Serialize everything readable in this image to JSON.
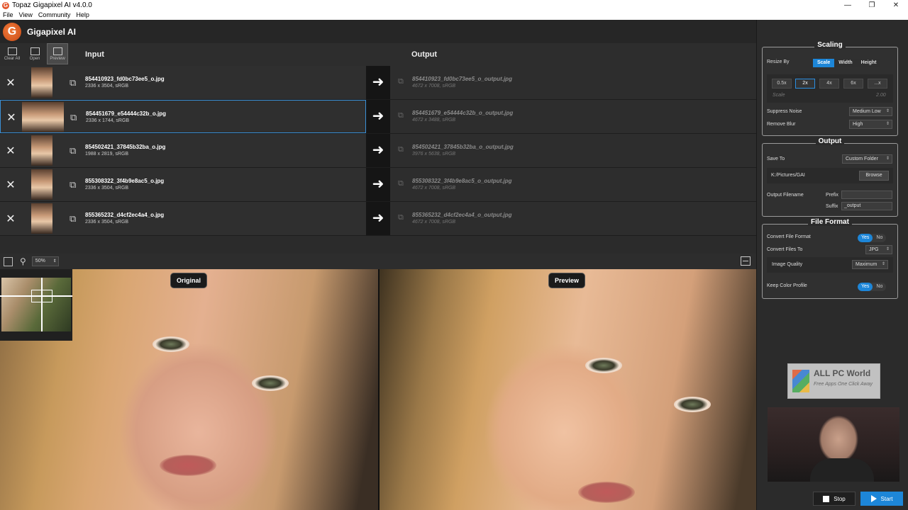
{
  "window": {
    "title": "Topaz Gigapixel AI v4.0.0"
  },
  "menu": [
    "File",
    "View",
    "Community",
    "Help"
  ],
  "app": {
    "name": "Gigapixel AI"
  },
  "toolbar": {
    "clear_all": "Clear All",
    "open": "Open",
    "preview": "Preview"
  },
  "columns": {
    "input": "Input",
    "output": "Output"
  },
  "files": [
    {
      "name": "854410923_fd0bc73ee5_o.jpg",
      "meta": "2336 x 3504, sRGB",
      "out_name": "854410923_fd0bc73ee5_o_output.jpg",
      "out_meta": "4672 x 7008, sRGB"
    },
    {
      "name": "854451679_e54444c32b_o.jpg",
      "meta": "2336 x 1744, sRGB",
      "out_name": "854451679_e54444c32b_o_output.jpg",
      "out_meta": "4672 x 3488, sRGB"
    },
    {
      "name": "854502421_37845b32ba_o.jpg",
      "meta": "1988 x 2819, sRGB",
      "out_name": "854502421_37845b32ba_o_output.jpg",
      "out_meta": "3976 x 5638, sRGB"
    },
    {
      "name": "855308322_3f4b9e8ac5_o.jpg",
      "meta": "2336 x 3504, sRGB",
      "out_name": "855308322_3f4b9e8ac5_o_output.jpg",
      "out_meta": "4672 x 7008, sRGB"
    },
    {
      "name": "855365232_d4cf2ec4a4_o.jpg",
      "meta": "2336 x 3504, sRGB",
      "out_name": "855365232_d4cf2ec4a4_o_output.jpg",
      "out_meta": "4672 x 7008, sRGB"
    }
  ],
  "selected_row": 1,
  "preview": {
    "zoom": "50%",
    "original_label": "Original",
    "preview_label": "Preview"
  },
  "scaling": {
    "title": "Scaling",
    "resize_by_label": "Resize By",
    "resize_options": [
      "Scale",
      "Width",
      "Height"
    ],
    "resize_selected": "Scale",
    "scale_buttons": [
      "0.5x",
      "2x",
      "4x",
      "6x",
      "...x"
    ],
    "scale_selected": "2x",
    "scale_label": "Scale",
    "scale_value": "2.00",
    "suppress_noise_label": "Suppress Noise",
    "suppress_noise_value": "Medium Low",
    "remove_blur_label": "Remove Blur",
    "remove_blur_value": "High"
  },
  "output": {
    "title": "Output",
    "save_to_label": "Save To",
    "save_to_value": "Custom Folder",
    "folder_path": "K:/Pictures/GAI",
    "browse": "Browse",
    "filename_label": "Output Filename",
    "prefix_label": "Prefix",
    "prefix_value": "",
    "suffix_label": "Suffix",
    "suffix_value": "_output"
  },
  "file_format": {
    "title": "File Format",
    "convert_label": "Convert File Format",
    "convert_to_label": "Convert Files To",
    "convert_to_value": "JPG",
    "image_quality_label": "Image Quality",
    "image_quality_value": "Maximum",
    "keep_profile_label": "Keep Color Profile",
    "yes": "Yes",
    "no": "No"
  },
  "watermark": {
    "title": "ALL PC World",
    "tagline": "Free Apps One Click Away"
  },
  "actions": {
    "stop": "Stop",
    "start": "Start"
  },
  "colors": {
    "accent": "#1d86d8",
    "selection": "#3a8fd6",
    "logo": "#e3542a"
  }
}
